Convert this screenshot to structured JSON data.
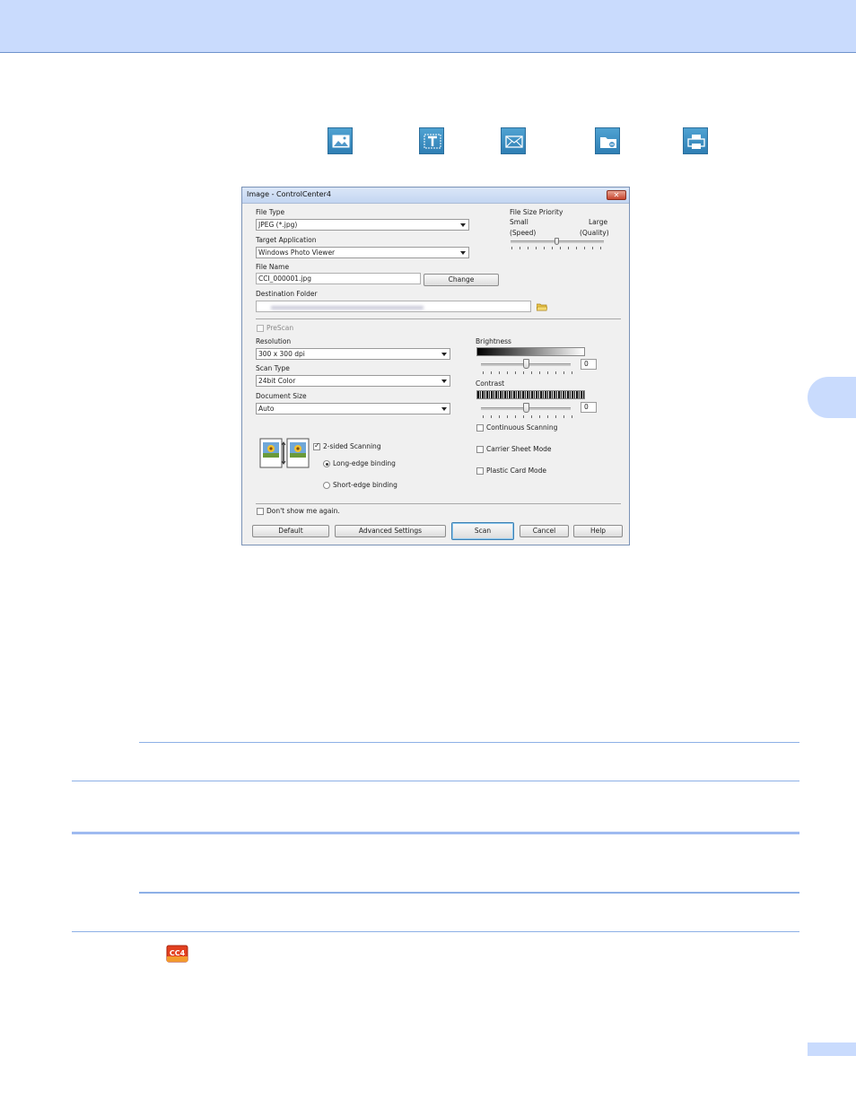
{
  "colors": {
    "header_band": "#c9dbfd",
    "accent_rule": "#8db0e6",
    "toolbar_icon": "#3a8bc2"
  },
  "toolbar_icons": [
    "image-icon",
    "text-ocr-icon",
    "email-icon",
    "folder-icon",
    "print-icon"
  ],
  "dialog": {
    "title": "Image - ControlCenter4",
    "file_type": {
      "label": "File Type",
      "value": "JPEG (*.jpg)"
    },
    "target_app": {
      "label": "Target Application",
      "value": "Windows Photo Viewer"
    },
    "file_name": {
      "label": "File Name",
      "value": "CCI_000001.jpg",
      "change_button": "Change"
    },
    "destination": {
      "label": "Destination Folder"
    },
    "file_size_priority": {
      "label": "File Size Priority",
      "small": "Small",
      "speed": "(Speed)",
      "large": "Large",
      "quality": "(Quality)",
      "level": 0.5
    },
    "prescan": "PreScan",
    "resolution": {
      "label": "Resolution",
      "value": "300 x 300 dpi"
    },
    "scan_type": {
      "label": "Scan Type",
      "value": "24bit Color"
    },
    "document_size": {
      "label": "Document Size",
      "value": "Auto"
    },
    "brightness": {
      "label": "Brightness",
      "value": "0",
      "level": 0.5
    },
    "contrast": {
      "label": "Contrast",
      "value": "0",
      "level": 0.5
    },
    "two_sided": "2-sided Scanning",
    "long_edge": "Long-edge binding",
    "short_edge": "Short-edge binding",
    "continuous": "Continuous Scanning",
    "carrier": "Carrier Sheet Mode",
    "plastic": "Plastic Card Mode",
    "dont_show": "Don't show me again.",
    "buttons": {
      "default": "Default",
      "advanced": "Advanced Settings",
      "scan": "Scan",
      "cancel": "Cancel",
      "help": "Help"
    }
  },
  "app_icon": {
    "name": "cc4-icon",
    "text": "CC4"
  }
}
